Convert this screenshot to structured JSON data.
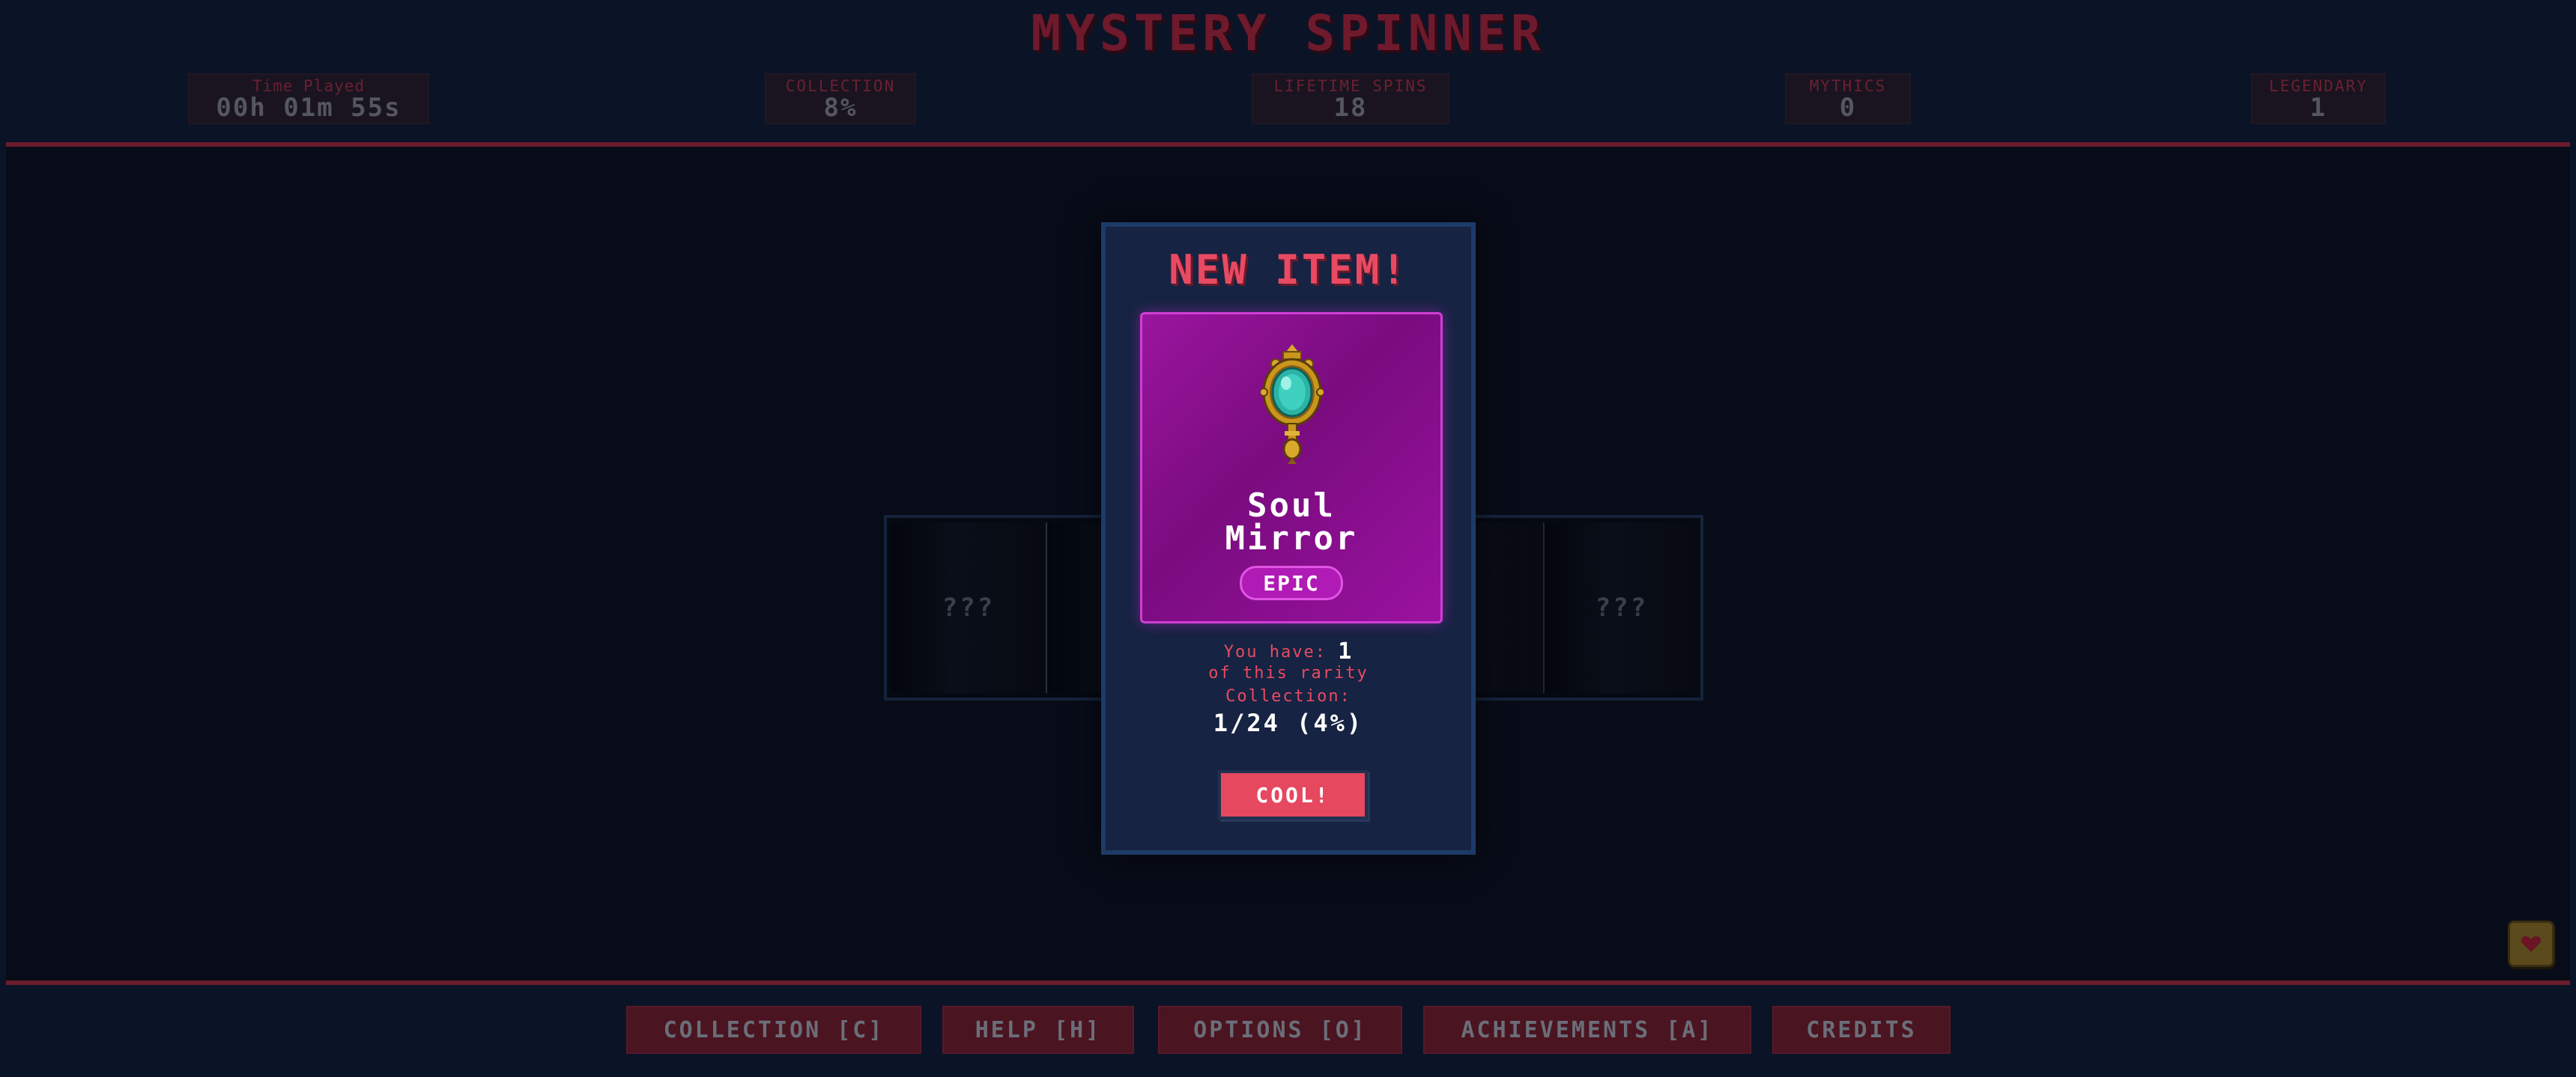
{
  "game": {
    "title": "MYSTERY SPINNER"
  },
  "stats": {
    "time_played": {
      "label": "Time Played",
      "value": "00h 01m 55s"
    },
    "collection": {
      "label": "COLLECTION",
      "value": "8%"
    },
    "lifetime_spins": {
      "label": "LIFETIME SPINS",
      "value": "18"
    },
    "mythics": {
      "label": "MYTHICS",
      "value": "0"
    },
    "legendary": {
      "label": "LEGENDARY",
      "value": "1"
    }
  },
  "reel": {
    "slots": [
      "???",
      "?",
      "",
      "?",
      "???"
    ]
  },
  "modal": {
    "title": "NEW ITEM!",
    "item": {
      "name_line1": "Soul",
      "name_line2": "Mirror",
      "rarity": "EPIC",
      "rarity_color": "#b01ab5",
      "icon": "hand-mirror-icon"
    },
    "you_have_label": "You have:",
    "you_have_count": "1",
    "of_rarity_text": "of this rarity",
    "collection_label": "Collection:",
    "collection_value": "1/24 (4%)",
    "confirm_label": "COOL!"
  },
  "nav": {
    "collection": "COLLECTION [C]",
    "help": "HELP [H]",
    "options": "OPTIONS [O]",
    "achievements": "ACHIEVEMENTS [A]",
    "credits": "CREDITS"
  },
  "colors": {
    "accent": "#e94a63",
    "epic": "#9a159e",
    "background": "#0b1426"
  }
}
